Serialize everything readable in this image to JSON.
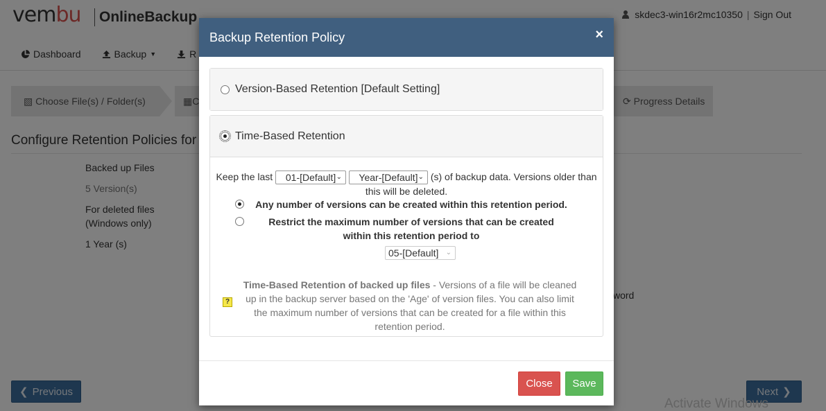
{
  "app": {
    "logo": {
      "part1": "ve",
      "part2": "m",
      "part3": "bu"
    },
    "product": "OnlineBackup",
    "user": "skdec3-win16r2mc10350",
    "sign_out": "Sign Out"
  },
  "nav": {
    "dashboard": "Dashboard",
    "backup": "Backup",
    "restore_partial": "R"
  },
  "wizard": {
    "step1": "Choose File(s) / Folder(s)",
    "step2_partial": "C",
    "step_last": "Progress Details"
  },
  "page": {
    "heading": "Configure Retention Policies for th",
    "backed_up_files": "Backed up Files",
    "versions": "5 Version(s)",
    "deleted_files_line1": "For deleted files",
    "deleted_files_line2": "(Windows only)",
    "year": "1 Year (s)",
    "word_partial": "word"
  },
  "footer_buttons": {
    "previous": "Previous",
    "next": "Next"
  },
  "watermark": "Activate Windows",
  "modal": {
    "title": "Backup Retention Policy",
    "close_x": "×",
    "version_based": "Version-Based Retention [Default Setting]",
    "time_based": "Time-Based Retention",
    "keep_prefix": "Keep the last",
    "keep_count": "01-[Default]",
    "keep_unit": "Year-[Default]",
    "keep_suffix": "(s) of backup data. Versions older than this will be deleted.",
    "option_any": "Any number of versions can be created within this retention period.",
    "option_restrict": "Restrict the maximum number of versions that can be created within this retention period to",
    "max_versions": "05-[Default]",
    "info_title": "Time-Based Retention of backed up files",
    "info_text": " - Versions of a file will be cleaned up in the backup server based on the 'Age' of version files. You can also limit the maximum number of versions that can be created for a file within this retention period.",
    "info_icon": "?",
    "close_button": "Close",
    "save_button": "Save"
  },
  "colors": {
    "modal_header": "#405f7f",
    "close_button": "#d9534f",
    "save_button": "#5cb85c",
    "nav_button": "#3c6e9e"
  }
}
